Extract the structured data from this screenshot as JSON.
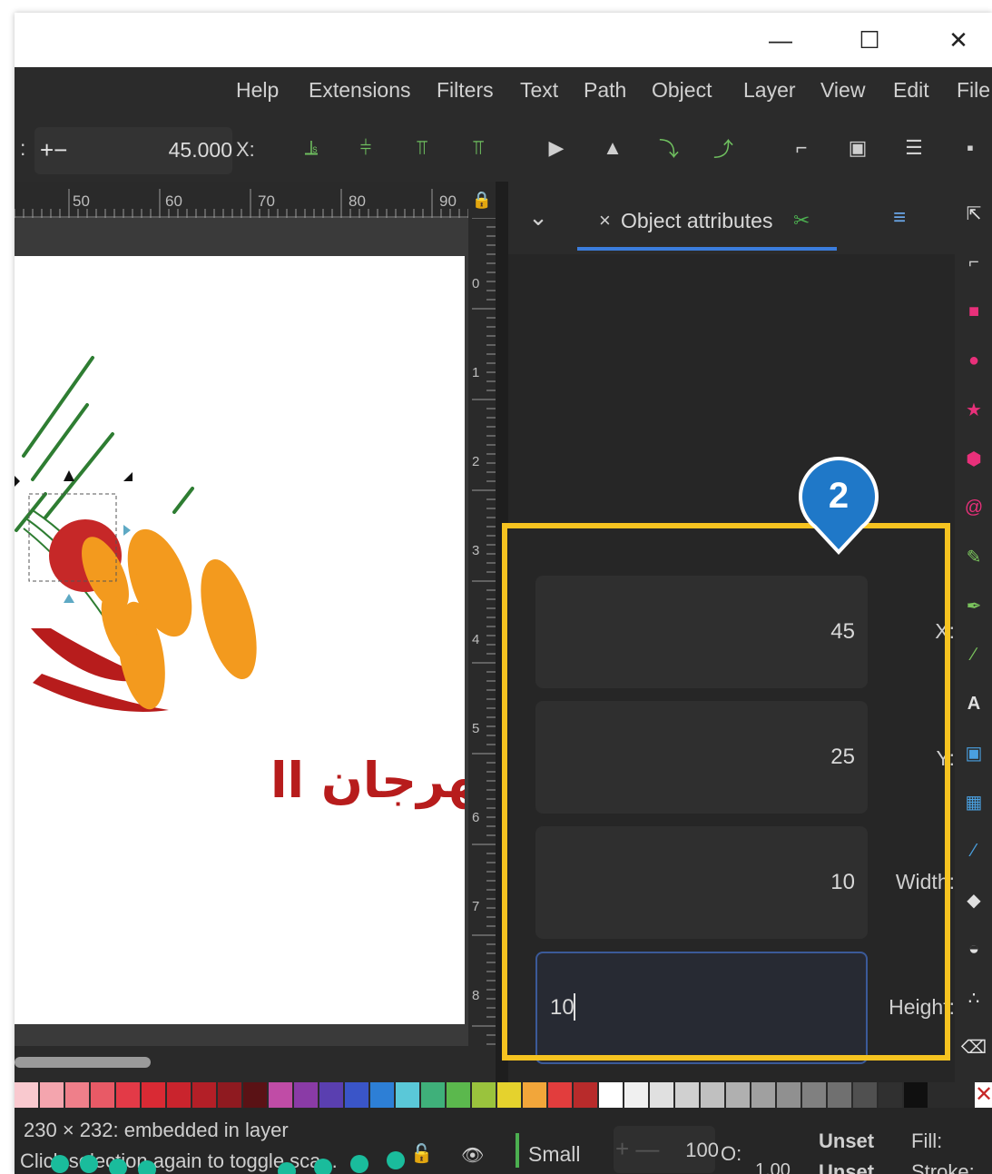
{
  "window": {
    "minimize_glyph": "—",
    "maximize_glyph": "☐",
    "close_glyph": "✕"
  },
  "menubar": {
    "items": [
      "Help",
      "Extensions",
      "Filters",
      "Text",
      "Path",
      "Object",
      "Layer",
      "View",
      "Edit",
      "File"
    ]
  },
  "toolbar": {
    "partial_label": ":",
    "stepper_glyph": "+−",
    "value": "45.000",
    "x_label": "X:"
  },
  "ruler": {
    "h_ticks": [
      "50",
      "60",
      "70",
      "80",
      "90"
    ],
    "v_ticks": [
      "0",
      "1",
      "2",
      "3",
      "4",
      "5",
      "6",
      "7",
      "8"
    ]
  },
  "canvas": {
    "artwork_text": "مهرجان اا"
  },
  "panel": {
    "dropdown_glyph": "⌄",
    "tab_close_glyph": "×",
    "tab_label": "Object attributes",
    "menu_glyph": "≡",
    "badge": "2",
    "fields": [
      {
        "label": "X:",
        "value": "45"
      },
      {
        "label": "Y:",
        "value": "25"
      },
      {
        "label": "Width:",
        "value": "10"
      },
      {
        "label": "Height:",
        "value": "10"
      }
    ]
  },
  "tools": [
    "selector-icon",
    "node-icon",
    "rect-icon",
    "circle-icon",
    "star-icon",
    "box3d-icon",
    "spiral-icon",
    "pencil-icon",
    "pen-icon",
    "calligraphy-icon",
    "text-icon",
    "gradient-icon",
    "mesh-icon",
    "dropper-icon",
    "paint-bucket-icon",
    "tweak-icon",
    "spray-icon",
    "eraser-icon"
  ],
  "tool_glyphs": [
    "⇱",
    "⌐",
    "■",
    "●",
    "★",
    "⬢",
    "@",
    "✎",
    "✒",
    "∕",
    "A",
    "▣",
    "▦",
    "⁄",
    "◆",
    "◒",
    "∴",
    "⌫"
  ],
  "palette": [
    "#f9c9cf",
    "#f4a5ae",
    "#ef7f8a",
    "#e85a66",
    "#e33a47",
    "#d92a34",
    "#c9242d",
    "#b31f27",
    "#8f1a20",
    "#5a1215",
    "#c04ca6",
    "#8a3ba6",
    "#5a3fb0",
    "#3a55c8",
    "#2d7fd6",
    "#5ac8d8",
    "#3fb07a",
    "#5bb84d",
    "#9ac33d",
    "#e5d22d",
    "#f2a63a",
    "#e23d3d",
    "#b82b2b",
    "#ffffff",
    "#f0f0f0",
    "#e0e0e0",
    "#d0d0d0",
    "#c0c0c0",
    "#b0b0b0",
    "#a0a0a0",
    "#909090",
    "#808080",
    "#707070",
    "#505050",
    "#303030",
    "#101010"
  ],
  "statusbar": {
    "line1": "230 × 232: embedded in layer",
    "line2": "Click selection again to toggle sca...",
    "lock_glyph": "🔓",
    "eye_glyph": "👁",
    "layer_name": "Small",
    "opacity_stepper": "+ —",
    "opacity_value": "100",
    "opacity_label": "O:",
    "stroke_width": "1.00",
    "fill_value": "Unset",
    "fill_label": "Fill:",
    "stroke_value": "Unset",
    "stroke_label": "Stroke:"
  }
}
